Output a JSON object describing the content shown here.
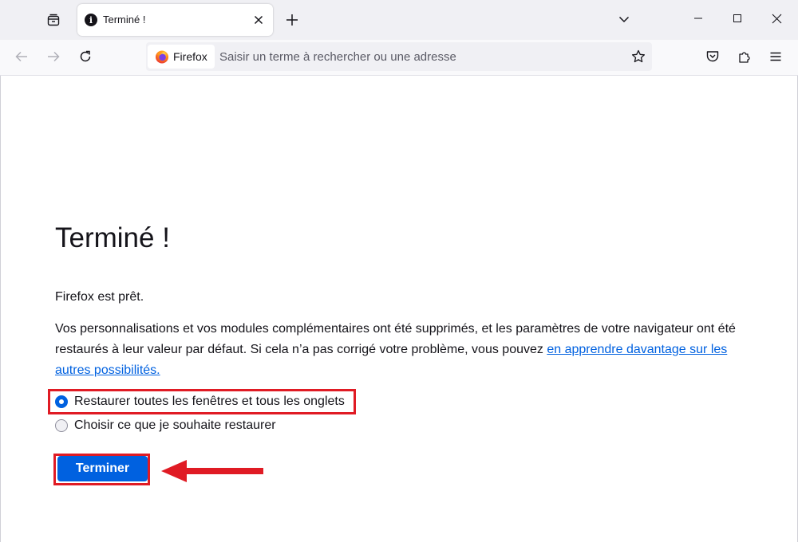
{
  "tabstrip": {
    "tabs": [
      {
        "title": "Terminé !",
        "active": true
      }
    ]
  },
  "navbar": {
    "identity_label": "Firefox",
    "url_placeholder": "Saisir un terme à rechercher ou une adresse",
    "url_value": ""
  },
  "page": {
    "title": "Terminé !",
    "ready_text": "Firefox est prêt.",
    "description": "Vos personnalisations et vos modules complémentaires ont été supprimés, et les paramètres de votre navigateur ont été restaurés à leur valeur par défaut. Si cela n’a pas corrigé votre problème, vous pouvez ",
    "learn_more_link": "en apprendre davantage sur les autres possibilités.",
    "options": [
      {
        "label": "Restaurer toutes les fenêtres et tous les onglets",
        "checked": true
      },
      {
        "label": "Choisir ce que je souhaite restaurer",
        "checked": false
      }
    ],
    "finish_button_label": "Terminer"
  },
  "colors": {
    "accent": "#0061e0",
    "annotation_red": "#e01b24",
    "chrome_background": "#f0f0f4"
  }
}
